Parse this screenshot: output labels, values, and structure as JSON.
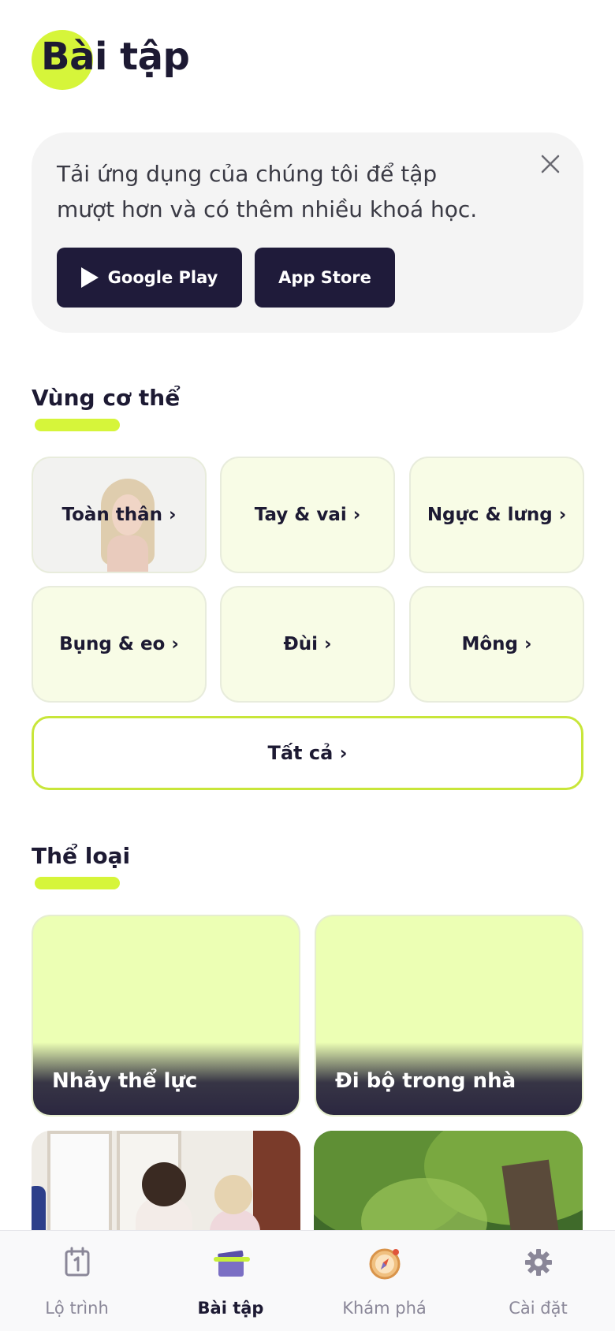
{
  "header": {
    "title": "Bài tập"
  },
  "banner": {
    "text": "Tải ứng dụng của chúng tôi để tập mượt hơn và có thêm nhiều khoá học.",
    "google_play_label": "Google Play",
    "app_store_label": "App Store"
  },
  "body_zones": {
    "title": "Vùng cơ thể",
    "items": [
      {
        "label": "Toàn thân ›"
      },
      {
        "label": "Tay & vai ›"
      },
      {
        "label": "Ngực & lưng ›"
      },
      {
        "label": "Bụng & eo ›"
      },
      {
        "label": "Đùi ›"
      },
      {
        "label": "Mông ›"
      }
    ],
    "all_label": "Tất cả ›"
  },
  "categories": {
    "title": "Thể loại",
    "items": [
      {
        "label": "Nhảy thể lực"
      },
      {
        "label": "Đi bộ trong nhà"
      }
    ]
  },
  "tabbar": {
    "items": [
      {
        "label": "Lộ trình",
        "icon": "calendar-icon"
      },
      {
        "label": "Bài tập",
        "icon": "clapperboard-icon",
        "active": true
      },
      {
        "label": "Khám phá",
        "icon": "compass-icon"
      },
      {
        "label": "Cài đặt",
        "icon": "gear-icon"
      }
    ]
  },
  "colors": {
    "accent": "#d6f53a",
    "dark": "#1f1b3a",
    "card_bg": "#f8fce6"
  }
}
